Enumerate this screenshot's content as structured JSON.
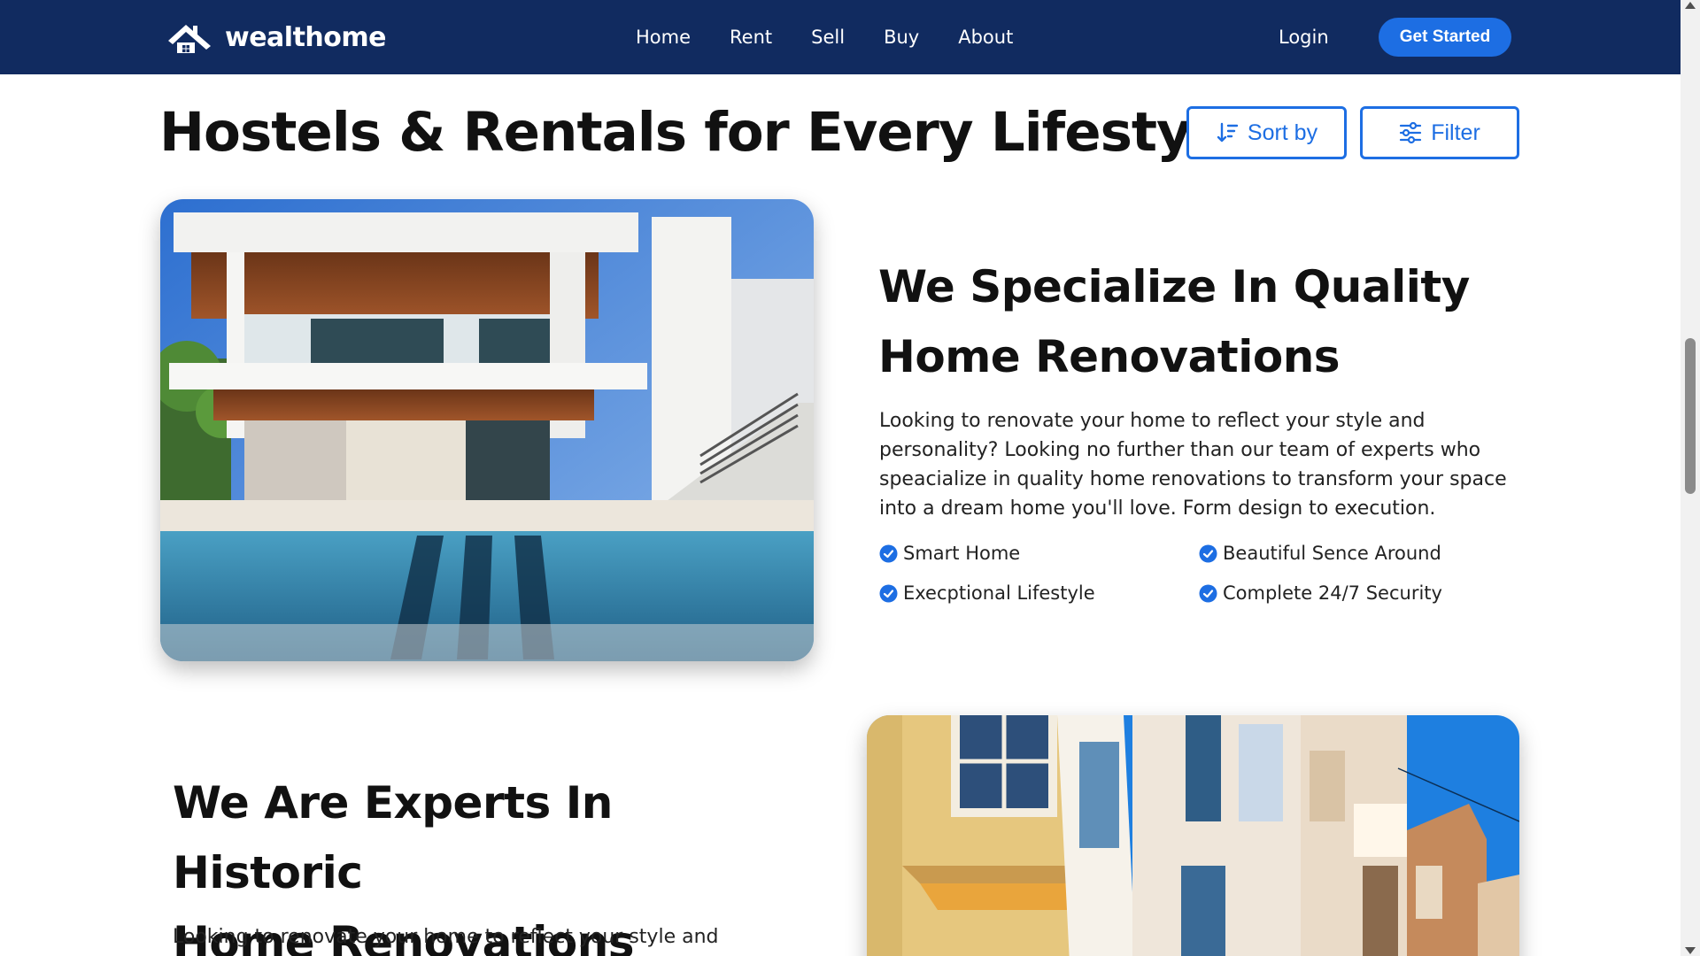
{
  "brand": {
    "name": "wealthome",
    "logo_icon": "house-logo-icon"
  },
  "nav": {
    "links": [
      "Home",
      "Rent",
      "Sell",
      "Buy",
      "About"
    ],
    "login": "Login",
    "cta": "Get Started"
  },
  "page": {
    "title": "Hostels & Rentals for Every Lifestyle",
    "sort_label": "Sort by",
    "filter_label": "Filter"
  },
  "sections": [
    {
      "title_line1": "We Specialize In Quality",
      "title_line2": "Home Renovations",
      "paragraph": "Looking to renovate your home to reflect your style and personality? Looking no further than our team of experts who speacialize in quality home renovations to transform your space into a dream home you'll love. Form design to execution.",
      "features": [
        "Smart Home",
        "Beautiful Sence Around",
        "Execptional Lifestyle",
        "Complete 24/7 Security"
      ]
    },
    {
      "title_line1": "We Are Experts In Historic",
      "title_line2": "Home Renovations",
      "paragraph": "Looking to renovate your home to reflect your style and"
    }
  ],
  "colors": {
    "navbar_bg": "#112b60",
    "accent": "#1d6ee3",
    "text": "#111111"
  }
}
